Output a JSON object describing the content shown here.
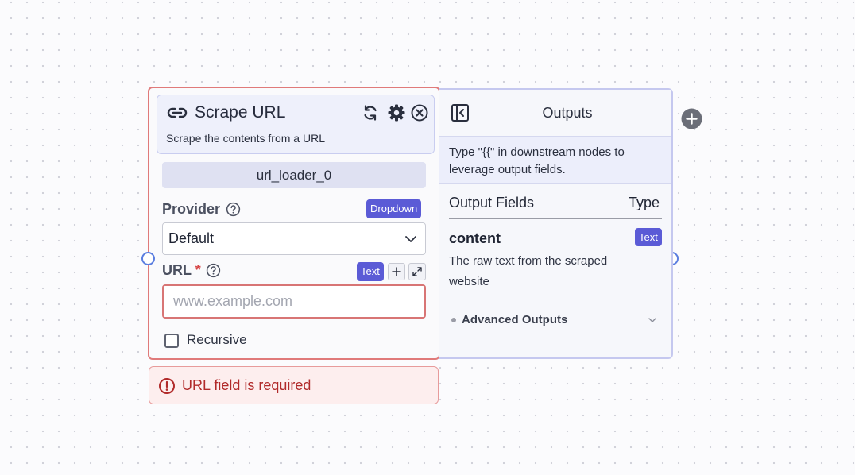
{
  "node": {
    "title": "Scrape URL",
    "description": "Scrape the contents from a URL",
    "node_id": "url_loader_0",
    "provider": {
      "label": "Provider",
      "type_badge": "Dropdown",
      "selected": "Default"
    },
    "url": {
      "label": "URL",
      "required_marker": "*",
      "type_badge": "Text",
      "value": "",
      "placeholder": "www.example.com"
    },
    "recursive": {
      "label": "Recursive",
      "checked": false
    }
  },
  "error": {
    "message": "URL field is required"
  },
  "outputs": {
    "title": "Outputs",
    "tip": "Type \"{{\" in downstream nodes to leverage output fields.",
    "col_fields": "Output Fields",
    "col_type": "Type",
    "fields": [
      {
        "name": "content",
        "type": "Text",
        "description": "The raw text from the scraped website"
      }
    ],
    "advanced_label": "Advanced Outputs"
  },
  "colors": {
    "accent": "#5b5bd6",
    "error": "#b12a2a",
    "error_border": "#e07a7a",
    "handle": "#5b7ee0"
  },
  "icons": [
    "link-icon",
    "refresh-icon",
    "gear-icon",
    "close-icon",
    "help-icon",
    "chevron-down-icon",
    "plus-icon",
    "expand-icon",
    "error-icon",
    "collapse-panel-icon",
    "add-node-icon"
  ]
}
